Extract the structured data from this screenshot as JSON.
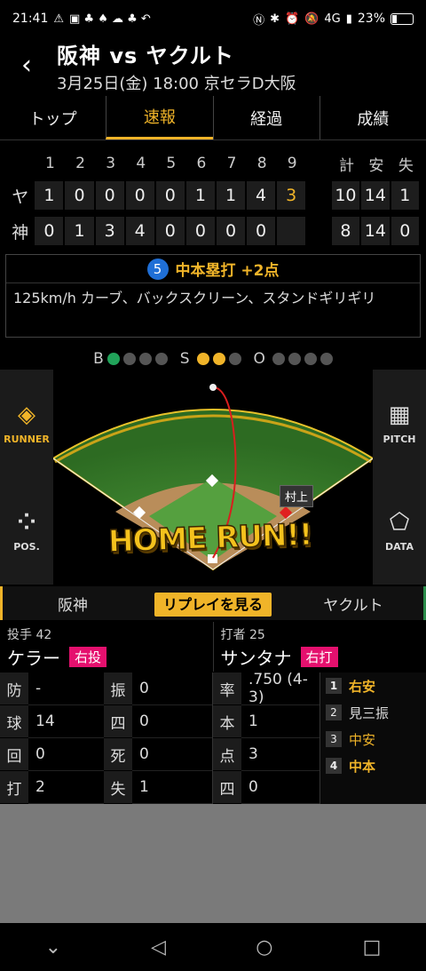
{
  "status": {
    "time": "21:41",
    "signal": "4G",
    "battery": "23%"
  },
  "header": {
    "title": "阪神 vs ヤクルト",
    "subtitle": "3月25日(金) 18:00 京セラD大阪"
  },
  "tabs": [
    "トップ",
    "速報",
    "経過",
    "成績"
  ],
  "active_tab": 1,
  "scoreboard": {
    "innings": [
      "1",
      "2",
      "3",
      "4",
      "5",
      "6",
      "7",
      "8",
      "9"
    ],
    "totals_header": [
      "計",
      "安",
      "失"
    ],
    "rows": [
      {
        "team": "ヤ",
        "scores": [
          "1",
          "0",
          "0",
          "0",
          "0",
          "1",
          "1",
          "4",
          "3"
        ],
        "totals": [
          "10",
          "14",
          "1"
        ]
      },
      {
        "team": "神",
        "scores": [
          "0",
          "1",
          "3",
          "4",
          "0",
          "0",
          "0",
          "0",
          ""
        ],
        "totals": [
          "8",
          "14",
          "0"
        ]
      }
    ]
  },
  "play": {
    "number": "5",
    "title": "中本塁打 +2点",
    "description": "125km/h カーブ、バックスクリーン、スタンドギリギリ"
  },
  "count": {
    "b_label": "B",
    "s_label": "S",
    "o_label": "O"
  },
  "field": {
    "runner_label": "RUNNER",
    "pitch_label": "PITCH",
    "pos_label": "POS.",
    "data_label": "DATA",
    "home_run": "HOME RUN!!",
    "runner_name": "村上"
  },
  "team_tabs": {
    "left": "阪神",
    "replay": "リプレイを見る",
    "right": "ヤクルト"
  },
  "pitcher": {
    "label": "投手",
    "number": "42",
    "name": "ケラー",
    "hand": "右投"
  },
  "batter": {
    "label": "打者",
    "number": "25",
    "name": "サンタナ",
    "hand": "右打"
  },
  "pitcher_stats": [
    {
      "k1": "防",
      "v1": "-",
      "k2": "振",
      "v2": "0"
    },
    {
      "k1": "球",
      "v1": "14",
      "k2": "四",
      "v2": "0"
    },
    {
      "k1": "回",
      "v1": "0",
      "k2": "死",
      "v2": "0"
    },
    {
      "k1": "打",
      "v1": "2",
      "k2": "失",
      "v2": "1"
    }
  ],
  "batter_stats": [
    {
      "k": "率",
      "v": ".750 (4-3)"
    },
    {
      "k": "本",
      "v": "1"
    },
    {
      "k": "点",
      "v": "3"
    },
    {
      "k": "四",
      "v": "0"
    }
  ],
  "at_bats": [
    {
      "n": "1",
      "result": "右安"
    },
    {
      "n": "2",
      "result": "見三振"
    },
    {
      "n": "3",
      "result": "中安"
    },
    {
      "n": "4",
      "result": "中本"
    }
  ]
}
